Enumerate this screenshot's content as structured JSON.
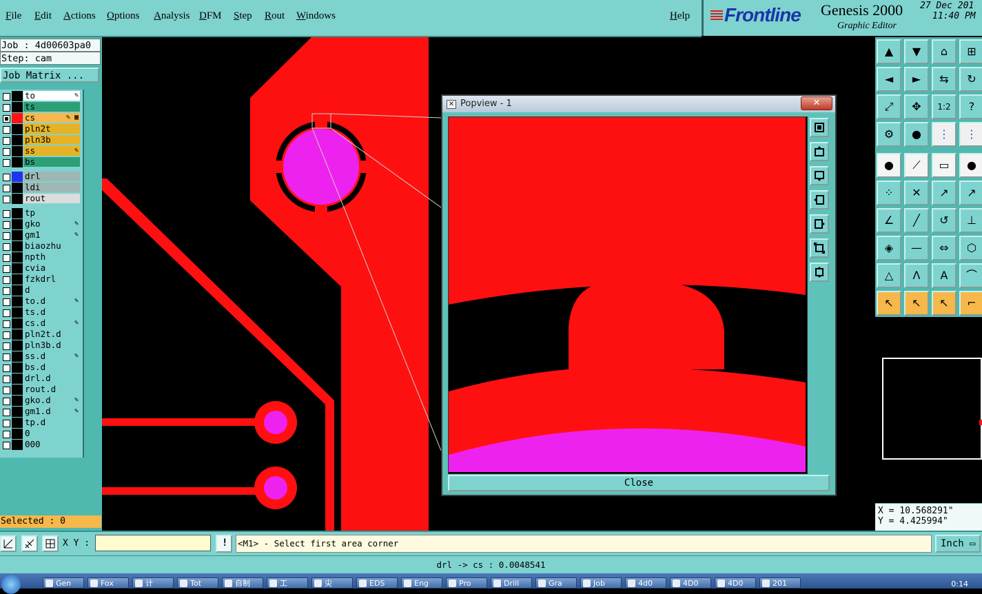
{
  "menu": [
    "File",
    "Edit",
    "Actions",
    "Options",
    "Analysis",
    "DFM",
    "Step",
    "Rout",
    "Windows"
  ],
  "help": "Help",
  "brand": {
    "logo": "Frontline",
    "product": "Genesis 2000",
    "subtitle": "Graphic Editor",
    "date": "27 Dec 201",
    "time": "11:40 PM"
  },
  "job": {
    "job_line": "Job : 4d00603pa0",
    "step_line": "Step: cam",
    "matrix_button": "Job Matrix ..."
  },
  "layers": [
    {
      "name": "to",
      "color": "#ffffff",
      "checked": false,
      "swatch": "#000000",
      "pen": "✎"
    },
    {
      "name": "ts",
      "color": "#2e9e77",
      "checked": false,
      "swatch": "#000000",
      "pen": ""
    },
    {
      "name": "cs",
      "color": "#f6b84a",
      "checked": true,
      "swatch": "#ff1414",
      "pen": "✎ ▦"
    },
    {
      "name": "pln2t",
      "color": "#e7b324",
      "checked": false,
      "swatch": "#000000",
      "pen": ""
    },
    {
      "name": "pln3b",
      "color": "#e7b324",
      "checked": false,
      "swatch": "#000000",
      "pen": ""
    },
    {
      "name": "ss",
      "color": "#e7b324",
      "checked": false,
      "swatch": "#000000",
      "pen": "✎"
    },
    {
      "name": "bs",
      "color": "#2e9e77",
      "checked": false,
      "swatch": "#000000",
      "pen": ""
    },
    {
      "name": "drl",
      "color": "#9fb7b4",
      "checked": false,
      "swatch": "#2233ee",
      "pen": ""
    },
    {
      "name": "ldi",
      "color": "#9fb7b4",
      "checked": false,
      "swatch": "#000000",
      "pen": ""
    },
    {
      "name": "rout",
      "color": "#dcdcdc",
      "checked": false,
      "swatch": "#000000",
      "pen": ""
    },
    {
      "name": "tp",
      "color": "#7fd3cf",
      "checked": false,
      "swatch": "#000000",
      "pen": ""
    },
    {
      "name": "gko",
      "color": "#7fd3cf",
      "checked": false,
      "swatch": "#000000",
      "pen": "✎"
    },
    {
      "name": "gm1",
      "color": "#7fd3cf",
      "checked": false,
      "swatch": "#000000",
      "pen": "✎"
    },
    {
      "name": "biaozhu",
      "color": "#7fd3cf",
      "checked": false,
      "swatch": "#000000",
      "pen": ""
    },
    {
      "name": "npth",
      "color": "#7fd3cf",
      "checked": false,
      "swatch": "#000000",
      "pen": ""
    },
    {
      "name": "cvia",
      "color": "#7fd3cf",
      "checked": false,
      "swatch": "#000000",
      "pen": ""
    },
    {
      "name": "fzkdrl",
      "color": "#7fd3cf",
      "checked": false,
      "swatch": "#000000",
      "pen": ""
    },
    {
      "name": "d",
      "color": "#7fd3cf",
      "checked": false,
      "swatch": "#000000",
      "pen": ""
    },
    {
      "name": "to.d",
      "color": "#7fd3cf",
      "checked": false,
      "swatch": "#000000",
      "pen": "✎"
    },
    {
      "name": "ts.d",
      "color": "#7fd3cf",
      "checked": false,
      "swatch": "#000000",
      "pen": ""
    },
    {
      "name": "cs.d",
      "color": "#7fd3cf",
      "checked": false,
      "swatch": "#000000",
      "pen": "✎"
    },
    {
      "name": "pln2t.d",
      "color": "#7fd3cf",
      "checked": false,
      "swatch": "#000000",
      "pen": ""
    },
    {
      "name": "pln3b.d",
      "color": "#7fd3cf",
      "checked": false,
      "swatch": "#000000",
      "pen": ""
    },
    {
      "name": "ss.d",
      "color": "#7fd3cf",
      "checked": false,
      "swatch": "#000000",
      "pen": "✎"
    },
    {
      "name": "bs.d",
      "color": "#7fd3cf",
      "checked": false,
      "swatch": "#000000",
      "pen": ""
    },
    {
      "name": "drl.d",
      "color": "#7fd3cf",
      "checked": false,
      "swatch": "#000000",
      "pen": ""
    },
    {
      "name": "rout.d",
      "color": "#7fd3cf",
      "checked": false,
      "swatch": "#000000",
      "pen": ""
    },
    {
      "name": "gko.d",
      "color": "#7fd3cf",
      "checked": false,
      "swatch": "#000000",
      "pen": "✎"
    },
    {
      "name": "gm1.d",
      "color": "#7fd3cf",
      "checked": false,
      "swatch": "#000000",
      "pen": "✎"
    },
    {
      "name": "tp.d",
      "color": "#7fd3cf",
      "checked": false,
      "swatch": "#000000",
      "pen": ""
    },
    {
      "name": "0",
      "color": "#7fd3cf",
      "checked": false,
      "swatch": "#000000",
      "pen": ""
    },
    {
      "name": "000",
      "color": "#7fd3cf",
      "checked": false,
      "swatch": "#000000",
      "pen": ""
    }
  ],
  "selected": "Selected : 0",
  "popview": {
    "title": "Popview - 1",
    "close_x": "✕",
    "close_button": "Close"
  },
  "coords": {
    "x": "X = 10.568291\"",
    "y": "Y = 4.425994\""
  },
  "command": {
    "xy_label": "X Y :",
    "xy_value": "",
    "prompt": "<M1> - Select first area corner",
    "unit": "Inch ▭"
  },
  "status": "drl -> cs : 0.0048541",
  "colors": {
    "copper": "#ff1010",
    "drill": "#ee22ee",
    "panel": "#7fd3cf",
    "panel_dark": "#4fb9b0",
    "highlight": "#f6b84a"
  },
  "taskbar": {
    "items": [
      "Gen",
      "Fox",
      "计",
      "Tot",
      "自制",
      "工",
      "尖",
      "EDS",
      "Eng",
      "Pro",
      "Drill",
      "Gra",
      "Job",
      "4d0",
      "4D0",
      "4D0",
      "201"
    ],
    "clock": "0:14"
  }
}
